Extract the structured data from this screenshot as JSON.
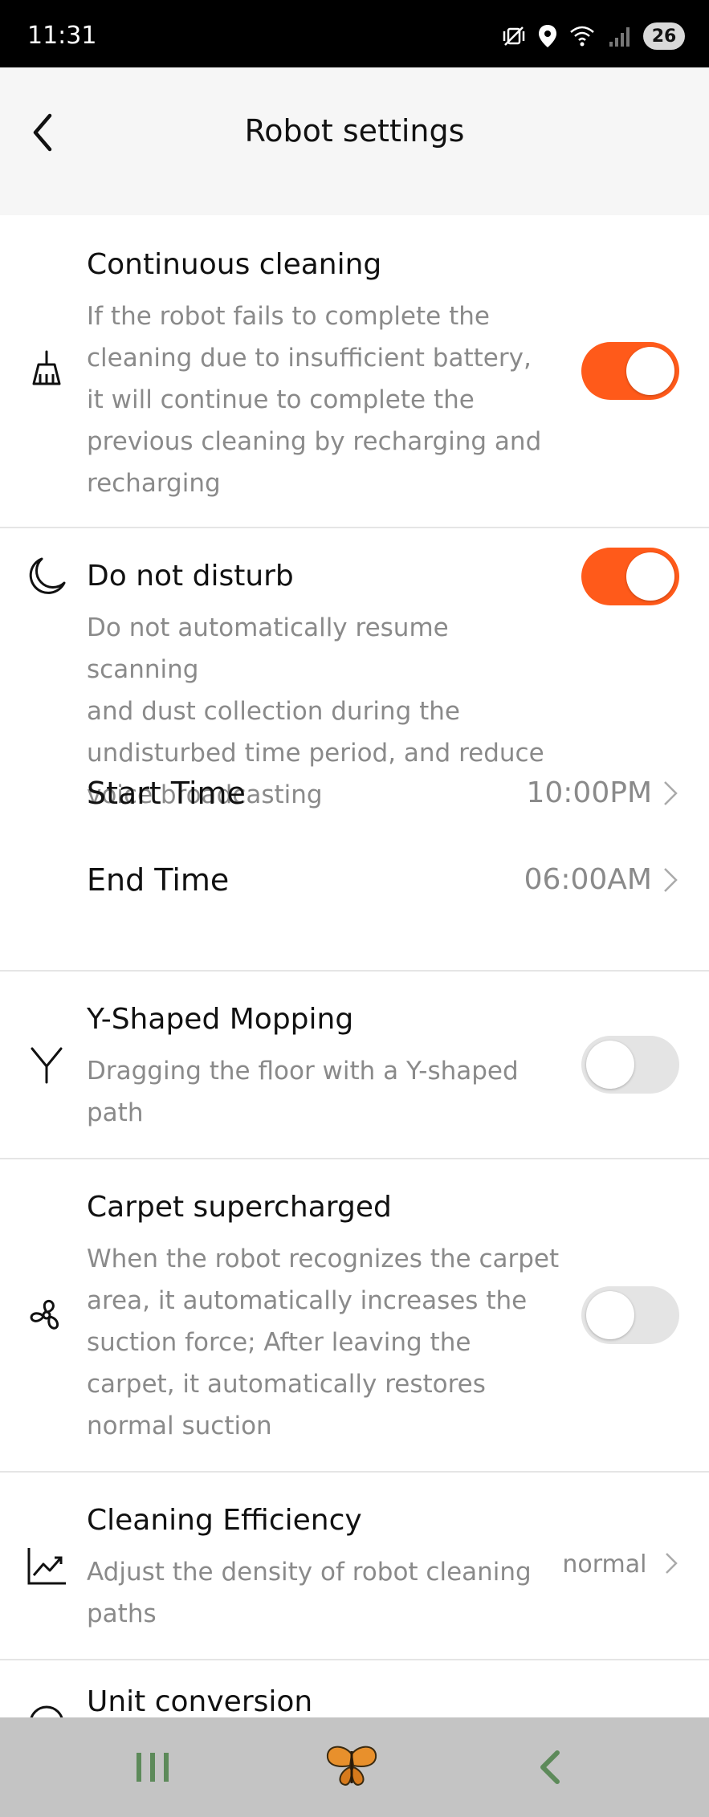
{
  "status_bar": {
    "time": "11:31",
    "battery": "26",
    "icons": [
      "mute-vibrate-icon",
      "location-icon",
      "wifi-icon",
      "signal-icon",
      "battery-icon"
    ]
  },
  "header": {
    "title": "Robot settings",
    "back_icon": "chevron-left-icon"
  },
  "settings": {
    "continuous_cleaning": {
      "icon": "broom-icon",
      "title": "Continuous cleaning",
      "desc_lines": [
        "If the robot fails to complete the",
        "cleaning due to insufficient battery,",
        "it will continue to complete the",
        "previous cleaning by recharging and",
        "recharging"
      ],
      "enabled": true
    },
    "do_not_disturb": {
      "icon": "moon-icon",
      "title": "Do not disturb",
      "desc_lines": [
        "Do not automatically resume scanning",
        "and dust collection during the",
        "undisturbed time period, and reduce",
        "voice broadcasting"
      ],
      "enabled": true,
      "start_label": "Start Time",
      "start_value": "10:00PM",
      "end_label": "End Time",
      "end_value": "06:00AM"
    },
    "y_shaped_mopping": {
      "icon": "y-shape-icon",
      "title": "Y-Shaped Mopping",
      "desc_lines": [
        "Dragging the floor with a Y-shaped",
        "path"
      ],
      "enabled": false
    },
    "carpet_supercharged": {
      "icon": "fan-icon",
      "title": "Carpet supercharged",
      "desc_lines": [
        "When the robot recognizes the carpet",
        "area, it automatically increases the",
        "suction force; After leaving the",
        "carpet, it automatically restores",
        "normal suction"
      ],
      "enabled": false
    },
    "cleaning_efficiency": {
      "icon": "trend-chart-icon",
      "title": "Cleaning Efficiency",
      "desc_lines": [
        "Adjust the density of robot cleaning",
        "paths"
      ],
      "value": "normal"
    },
    "unit_conversion": {
      "title": "Unit conversion"
    }
  },
  "colors": {
    "accent": "#ff5a1a",
    "toggle_off": "#e4e4e4",
    "nav_bar": "#c4c4c4",
    "nav_icon": "#5d8a5a"
  },
  "nav_bar": {
    "icons": [
      "recent-apps-icon",
      "butterfly-icon",
      "back-icon"
    ]
  }
}
